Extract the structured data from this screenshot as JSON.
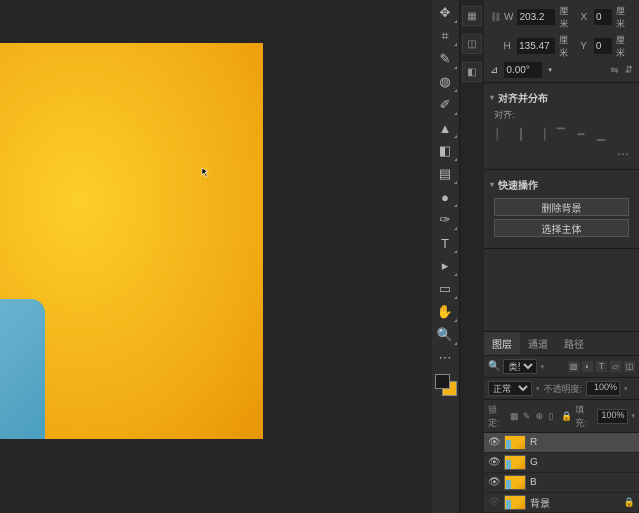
{
  "properties": {
    "W_label": "W",
    "W_value": "203.2",
    "W_unit": "厘米",
    "X_label": "X",
    "X_value": "0",
    "X_unit": "厘米",
    "H_label": "H",
    "H_value": "135.47",
    "H_unit": "厘米",
    "Y_label": "Y",
    "Y_value": "0",
    "Y_unit": "厘米",
    "angle_value": "0.00°"
  },
  "align": {
    "title": "对齐并分布",
    "label": "对齐:"
  },
  "quick": {
    "title": "快速操作",
    "remove_bg": "删除背景",
    "select_subject": "选择主体"
  },
  "layers_panel": {
    "tabs": {
      "layers": "图层",
      "channels": "通道",
      "paths": "路径"
    },
    "filter_kind": "类型",
    "blend_mode": "正常",
    "opacity_label": "不透明度:",
    "opacity_value": "100%",
    "lock_label": "锁定:",
    "fill_label": "填充:",
    "fill_value": "100%"
  },
  "layers": [
    {
      "name": "R",
      "visible": true,
      "selected": true,
      "locked": false
    },
    {
      "name": "G",
      "visible": true,
      "selected": false,
      "locked": false
    },
    {
      "name": "B",
      "visible": true,
      "selected": false,
      "locked": false
    },
    {
      "name": "背景",
      "visible": false,
      "selected": false,
      "locked": true
    }
  ]
}
